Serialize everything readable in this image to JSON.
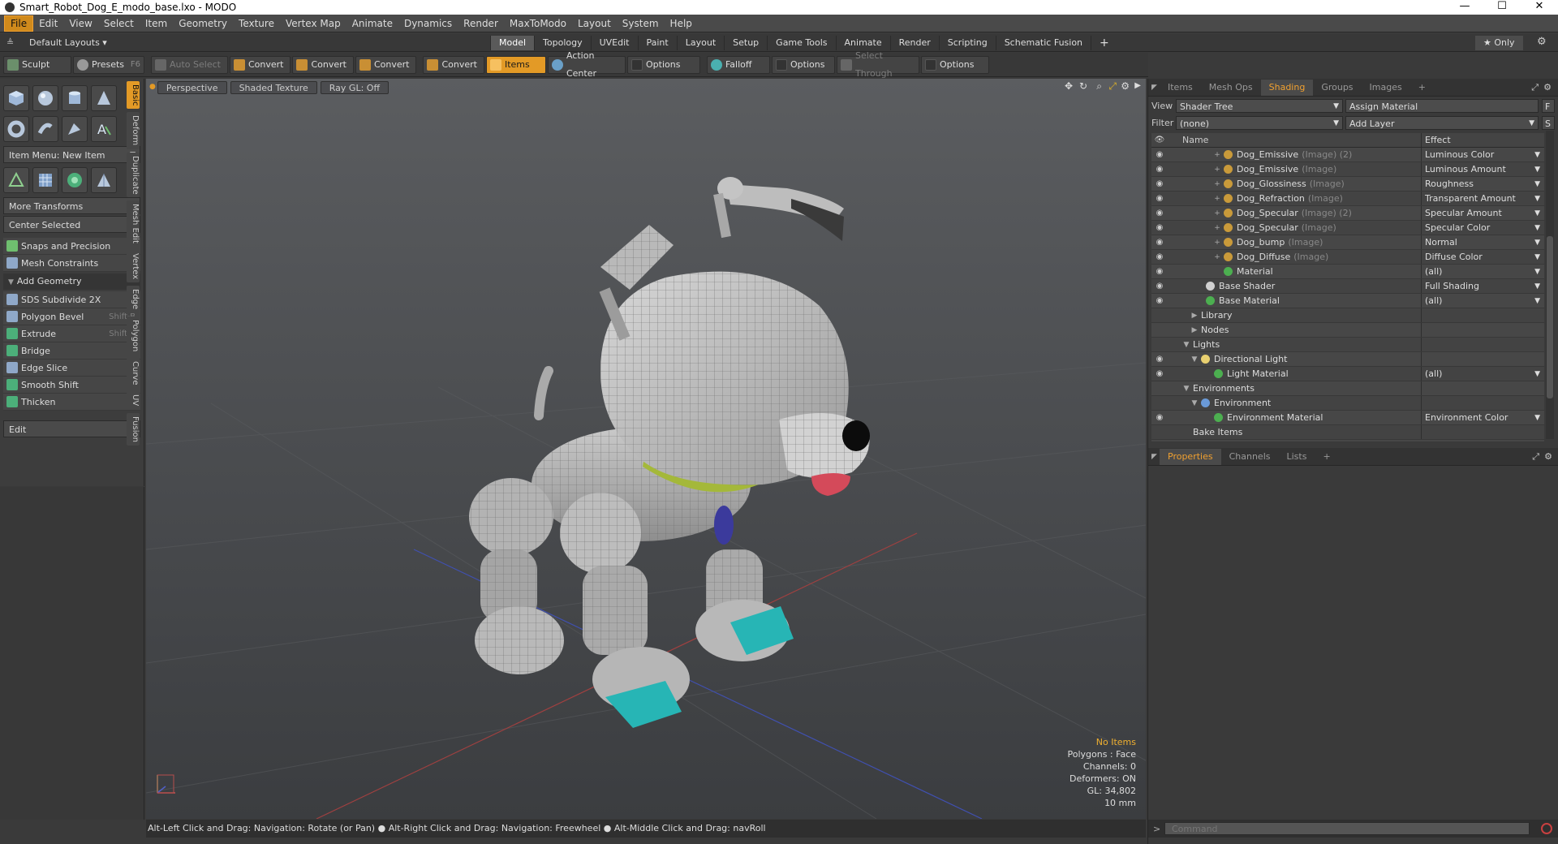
{
  "window": {
    "title": "Smart_Robot_Dog_E_modo_base.lxo - MODO",
    "min": "—",
    "max": "☐",
    "close": "✕"
  },
  "menu": [
    "File",
    "Edit",
    "View",
    "Select",
    "Item",
    "Geometry",
    "Texture",
    "Vertex Map",
    "Animate",
    "Dynamics",
    "Render",
    "MaxToModo",
    "Layout",
    "System",
    "Help"
  ],
  "layout": {
    "preset": "Default Layouts ▾",
    "tabs": [
      "Model",
      "Topology",
      "UVEdit",
      "Paint",
      "Layout",
      "Setup",
      "Game Tools",
      "Animate",
      "Render",
      "Scripting",
      "Schematic Fusion"
    ],
    "active_tab": "Model",
    "add": "+",
    "only": "★  Only",
    "gear": "⚙"
  },
  "toolbar": {
    "sculpt": "Sculpt",
    "presets": "Presets",
    "presets_key": "F6",
    "auto_select": "Auto Select",
    "convert1": "Convert",
    "convert2": "Convert",
    "convert3": "Convert",
    "convert4": "Convert",
    "items": "Items",
    "action_center": "Action Center",
    "options1": "Options",
    "falloff": "Falloff",
    "options2": "Options",
    "select_through": "Select Through",
    "options3": "Options"
  },
  "left": {
    "item_menu": "Item Menu: New Item",
    "more_transforms": "More Transforms",
    "center_selected": "Center Selected",
    "snaps": "Snaps and Precision",
    "mesh_constraints": "Mesh Constraints",
    "add_geometry": "Add Geometry",
    "tools": [
      {
        "label": "SDS Subdivide 2X",
        "key": ""
      },
      {
        "label": "Polygon Bevel",
        "key": "Shift-B"
      },
      {
        "label": "Extrude",
        "key": "Shift-X"
      },
      {
        "label": "Bridge",
        "key": ""
      },
      {
        "label": "Edge Slice",
        "key": ""
      },
      {
        "label": "Smooth Shift",
        "key": ""
      },
      {
        "label": "Thicken",
        "key": ""
      }
    ],
    "edit": "Edit",
    "side_tabs": [
      "Basic",
      "Deform",
      "Duplicate",
      "Mesh Edit",
      "Vertex",
      "Edge",
      "Polygon",
      "Curve",
      "UV",
      "Fusion"
    ]
  },
  "viewport": {
    "perspective": "Perspective",
    "shading": "Shaded Texture",
    "raygl": "Ray GL: Off",
    "info": {
      "no_items": "No Items",
      "polygons": "Polygons : Face",
      "channels": "Channels: 0",
      "deformers": "Deformers: ON",
      "gl": "GL: 34,802",
      "scale": "10 mm"
    }
  },
  "status": "Alt-Left Click and Drag: Navigation: Rotate (or Pan) ● Alt-Right Click and Drag: Navigation: Freewheel ● Alt-Middle Click and Drag: navRoll",
  "right": {
    "tabs": [
      "Items",
      "Mesh Ops",
      "Shading",
      "Groups",
      "Images"
    ],
    "active_tab": "Shading",
    "add": "+",
    "view_label": "View",
    "view_value": "Shader Tree",
    "assign_material": "Assign Material",
    "f_btn": "F",
    "filter_label": "Filter",
    "filter_value": "(none)",
    "add_layer": "Add Layer",
    "s_btn": "S",
    "col_name": "Name",
    "col_effect": "Effect",
    "rows": [
      {
        "name": "Dog_Emissive",
        "suffix": "(Image) (2)",
        "effect": "Luminous Color",
        "eye": true,
        "exp": "+",
        "indent": 38,
        "color": "#c99a3a",
        "dd": true
      },
      {
        "name": "Dog_Emissive",
        "suffix": "(Image)",
        "effect": "Luminous Amount",
        "eye": true,
        "exp": "+",
        "indent": 38,
        "color": "#c99a3a",
        "dd": true
      },
      {
        "name": "Dog_Glossiness",
        "suffix": "(Image)",
        "effect": "Roughness",
        "eye": true,
        "exp": "+",
        "indent": 38,
        "color": "#c99a3a",
        "dd": true
      },
      {
        "name": "Dog_Refraction",
        "suffix": "(Image)",
        "effect": "Transparent Amount",
        "eye": true,
        "exp": "+",
        "indent": 38,
        "color": "#c99a3a",
        "dd": true
      },
      {
        "name": "Dog_Specular",
        "suffix": "(Image) (2)",
        "effect": "Specular Amount",
        "eye": true,
        "exp": "+",
        "indent": 38,
        "color": "#c99a3a",
        "dd": true
      },
      {
        "name": "Dog_Specular",
        "suffix": "(Image)",
        "effect": "Specular Color",
        "eye": true,
        "exp": "+",
        "indent": 38,
        "color": "#c99a3a",
        "dd": true
      },
      {
        "name": "Dog_bump",
        "suffix": "(Image)",
        "effect": "Normal",
        "eye": true,
        "exp": "+",
        "indent": 38,
        "color": "#c99a3a",
        "dd": true
      },
      {
        "name": "Dog_Diffuse",
        "suffix": "(Image)",
        "effect": "Diffuse Color",
        "eye": true,
        "exp": "+",
        "indent": 38,
        "color": "#c99a3a",
        "dd": true
      },
      {
        "name": "Material",
        "suffix": "",
        "effect": "(all)",
        "eye": true,
        "exp": "",
        "indent": 38,
        "color": "#4caf50",
        "dd": true
      },
      {
        "name": "Base Shader",
        "suffix": "",
        "effect": "Full Shading",
        "eye": true,
        "exp": "",
        "indent": 16,
        "color": "#d0d0d0",
        "dd": true
      },
      {
        "name": "Base Material",
        "suffix": "",
        "effect": "(all)",
        "eye": true,
        "exp": "",
        "indent": 16,
        "color": "#4caf50",
        "dd": true
      },
      {
        "name": "Library",
        "suffix": "",
        "effect": "",
        "eye": false,
        "exp": "▶",
        "indent": 10,
        "color": "",
        "dd": false
      },
      {
        "name": "Nodes",
        "suffix": "",
        "effect": "",
        "eye": false,
        "exp": "▶",
        "indent": 10,
        "color": "",
        "dd": false
      },
      {
        "name": "Lights",
        "suffix": "",
        "effect": "",
        "eye": false,
        "exp": "▼",
        "indent": 0,
        "color": "",
        "dd": false
      },
      {
        "name": "Directional Light",
        "suffix": "",
        "effect": "",
        "eye": true,
        "exp": "▼",
        "indent": 10,
        "color": "#e8d070",
        "dd": false
      },
      {
        "name": "Light Material",
        "suffix": "",
        "effect": "(all)",
        "eye": true,
        "exp": "",
        "indent": 26,
        "color": "#4caf50",
        "dd": true
      },
      {
        "name": "Environments",
        "suffix": "",
        "effect": "",
        "eye": false,
        "exp": "▼",
        "indent": 0,
        "color": "",
        "dd": false
      },
      {
        "name": "Environment",
        "suffix": "",
        "effect": "",
        "eye": false,
        "exp": "▼",
        "indent": 10,
        "color": "#6a9ad8",
        "dd": false
      },
      {
        "name": "Environment Material",
        "suffix": "",
        "effect": "Environment Color",
        "eye": true,
        "exp": "",
        "indent": 26,
        "color": "#4caf50",
        "dd": true
      },
      {
        "name": "Bake Items",
        "suffix": "",
        "effect": "",
        "eye": false,
        "exp": "",
        "indent": 0,
        "color": "",
        "dd": false
      }
    ],
    "prop_tabs": [
      "Properties",
      "Channels",
      "Lists"
    ],
    "prop_active": "Properties",
    "cmd_placeholder": "Command",
    "cmd_arrow": ">"
  }
}
